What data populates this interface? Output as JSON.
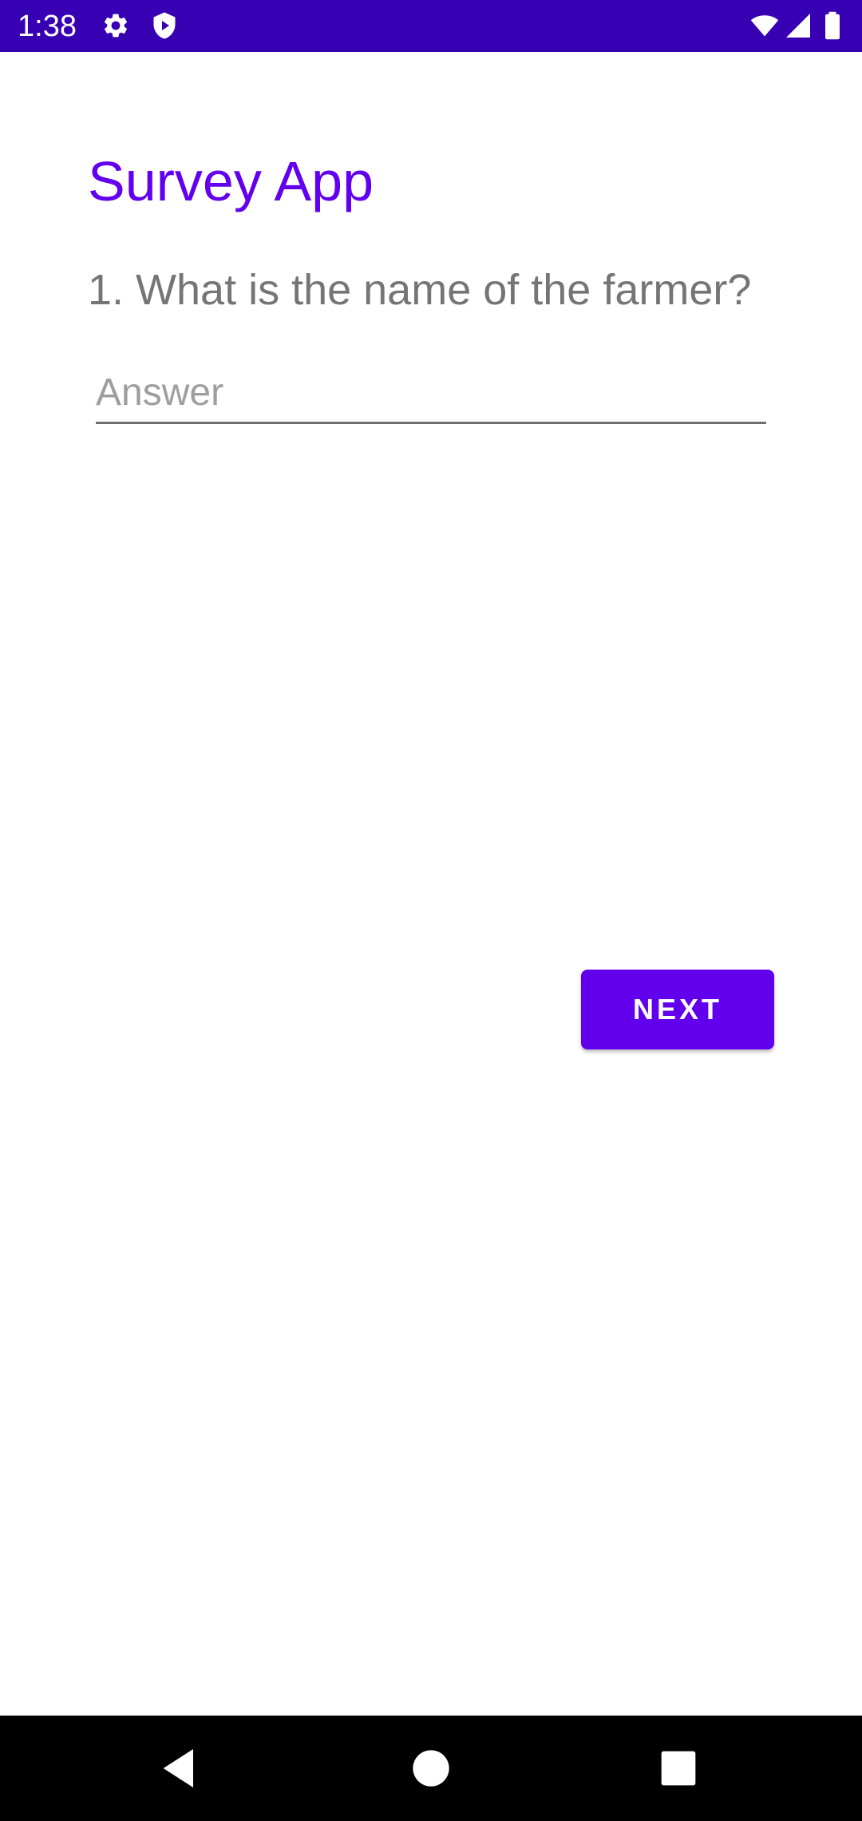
{
  "status_bar": {
    "time": "1:38",
    "icons_left": [
      "gear-icon",
      "shield-icon"
    ],
    "icons_right": [
      "wifi-icon",
      "signal-icon",
      "battery-icon"
    ],
    "background": "#3700b3"
  },
  "app": {
    "title": "Survey App",
    "accent_color": "#6200ee"
  },
  "question": {
    "text": "1. What is the name of the farmer?"
  },
  "answer": {
    "value": "",
    "placeholder": "Answer"
  },
  "next_button": {
    "label": "NEXT"
  },
  "nav_bar": {
    "buttons": [
      "back-icon",
      "home-icon",
      "recents-icon"
    ]
  }
}
